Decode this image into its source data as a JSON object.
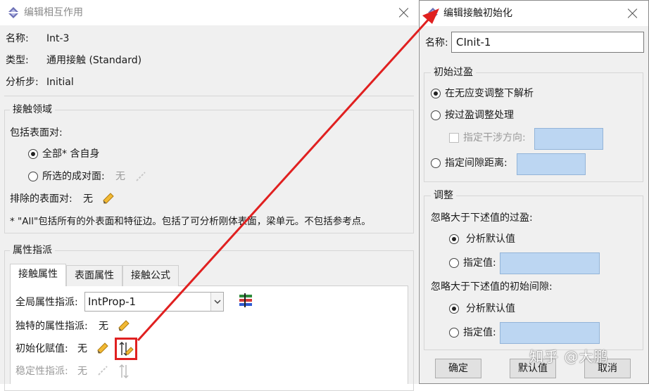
{
  "left_dialog": {
    "title": "编辑相互作用",
    "name_label": "名称:",
    "name_value": "Int-3",
    "type_label": "类型:",
    "type_value": "通用接触 (Standard)",
    "step_label": "分析步:",
    "step_value": "Initial",
    "contact_domain": {
      "title": "接触领域",
      "include_label": "包括表面对:",
      "option_all": "全部* 含自身",
      "option_selected": "所选的成对面:",
      "selected_value": "无",
      "exclude_label": "排除的表面对:",
      "exclude_value": "无",
      "note": "* \"All\"包括所有的外表面和特征边。包括了可分析刚体表面，梁单元。不包括参考点。"
    },
    "property_assignment": {
      "title": "属性指派",
      "tabs": [
        "接触属性",
        "表面属性",
        "接触公式"
      ],
      "global_label": "全局属性指派:",
      "global_value": "IntProp-1",
      "unique_label": "独特的属性指派:",
      "unique_value": "无",
      "init_label": "初始化赋值:",
      "init_value": "无",
      "stab_label": "稳定性指派:",
      "stab_value": "无"
    }
  },
  "right_dialog": {
    "title": "编辑接触初始化",
    "name_label": "名称:",
    "name_value": "CInit-1",
    "initial_overclosure": {
      "title": "初始过盈",
      "opt_strain_free": "在无应变调整下解析",
      "opt_interference": "按过盈调整处理",
      "check_direction": "指定干涉方向:",
      "opt_clearance": "指定间隙距离:"
    },
    "adjust": {
      "title": "调整",
      "ignore_over_label": "忽略大于下述值的过盈:",
      "default_1": "分析默认值",
      "specify_1": "指定值:",
      "ignore_gap_label": "忽略大于下述值的初始间隙:",
      "default_2": "分析默认值",
      "specify_2": "指定值:"
    },
    "buttons": {
      "ok": "确定",
      "defaults": "默认值",
      "cancel": "取消"
    }
  },
  "watermark": "知乎 @大鹏",
  "colors": {
    "arrow": "#e02020",
    "highlight_box": "#e02020",
    "field_blue": "#bcd6f2",
    "dialog_bg": "#f0f0f0"
  }
}
